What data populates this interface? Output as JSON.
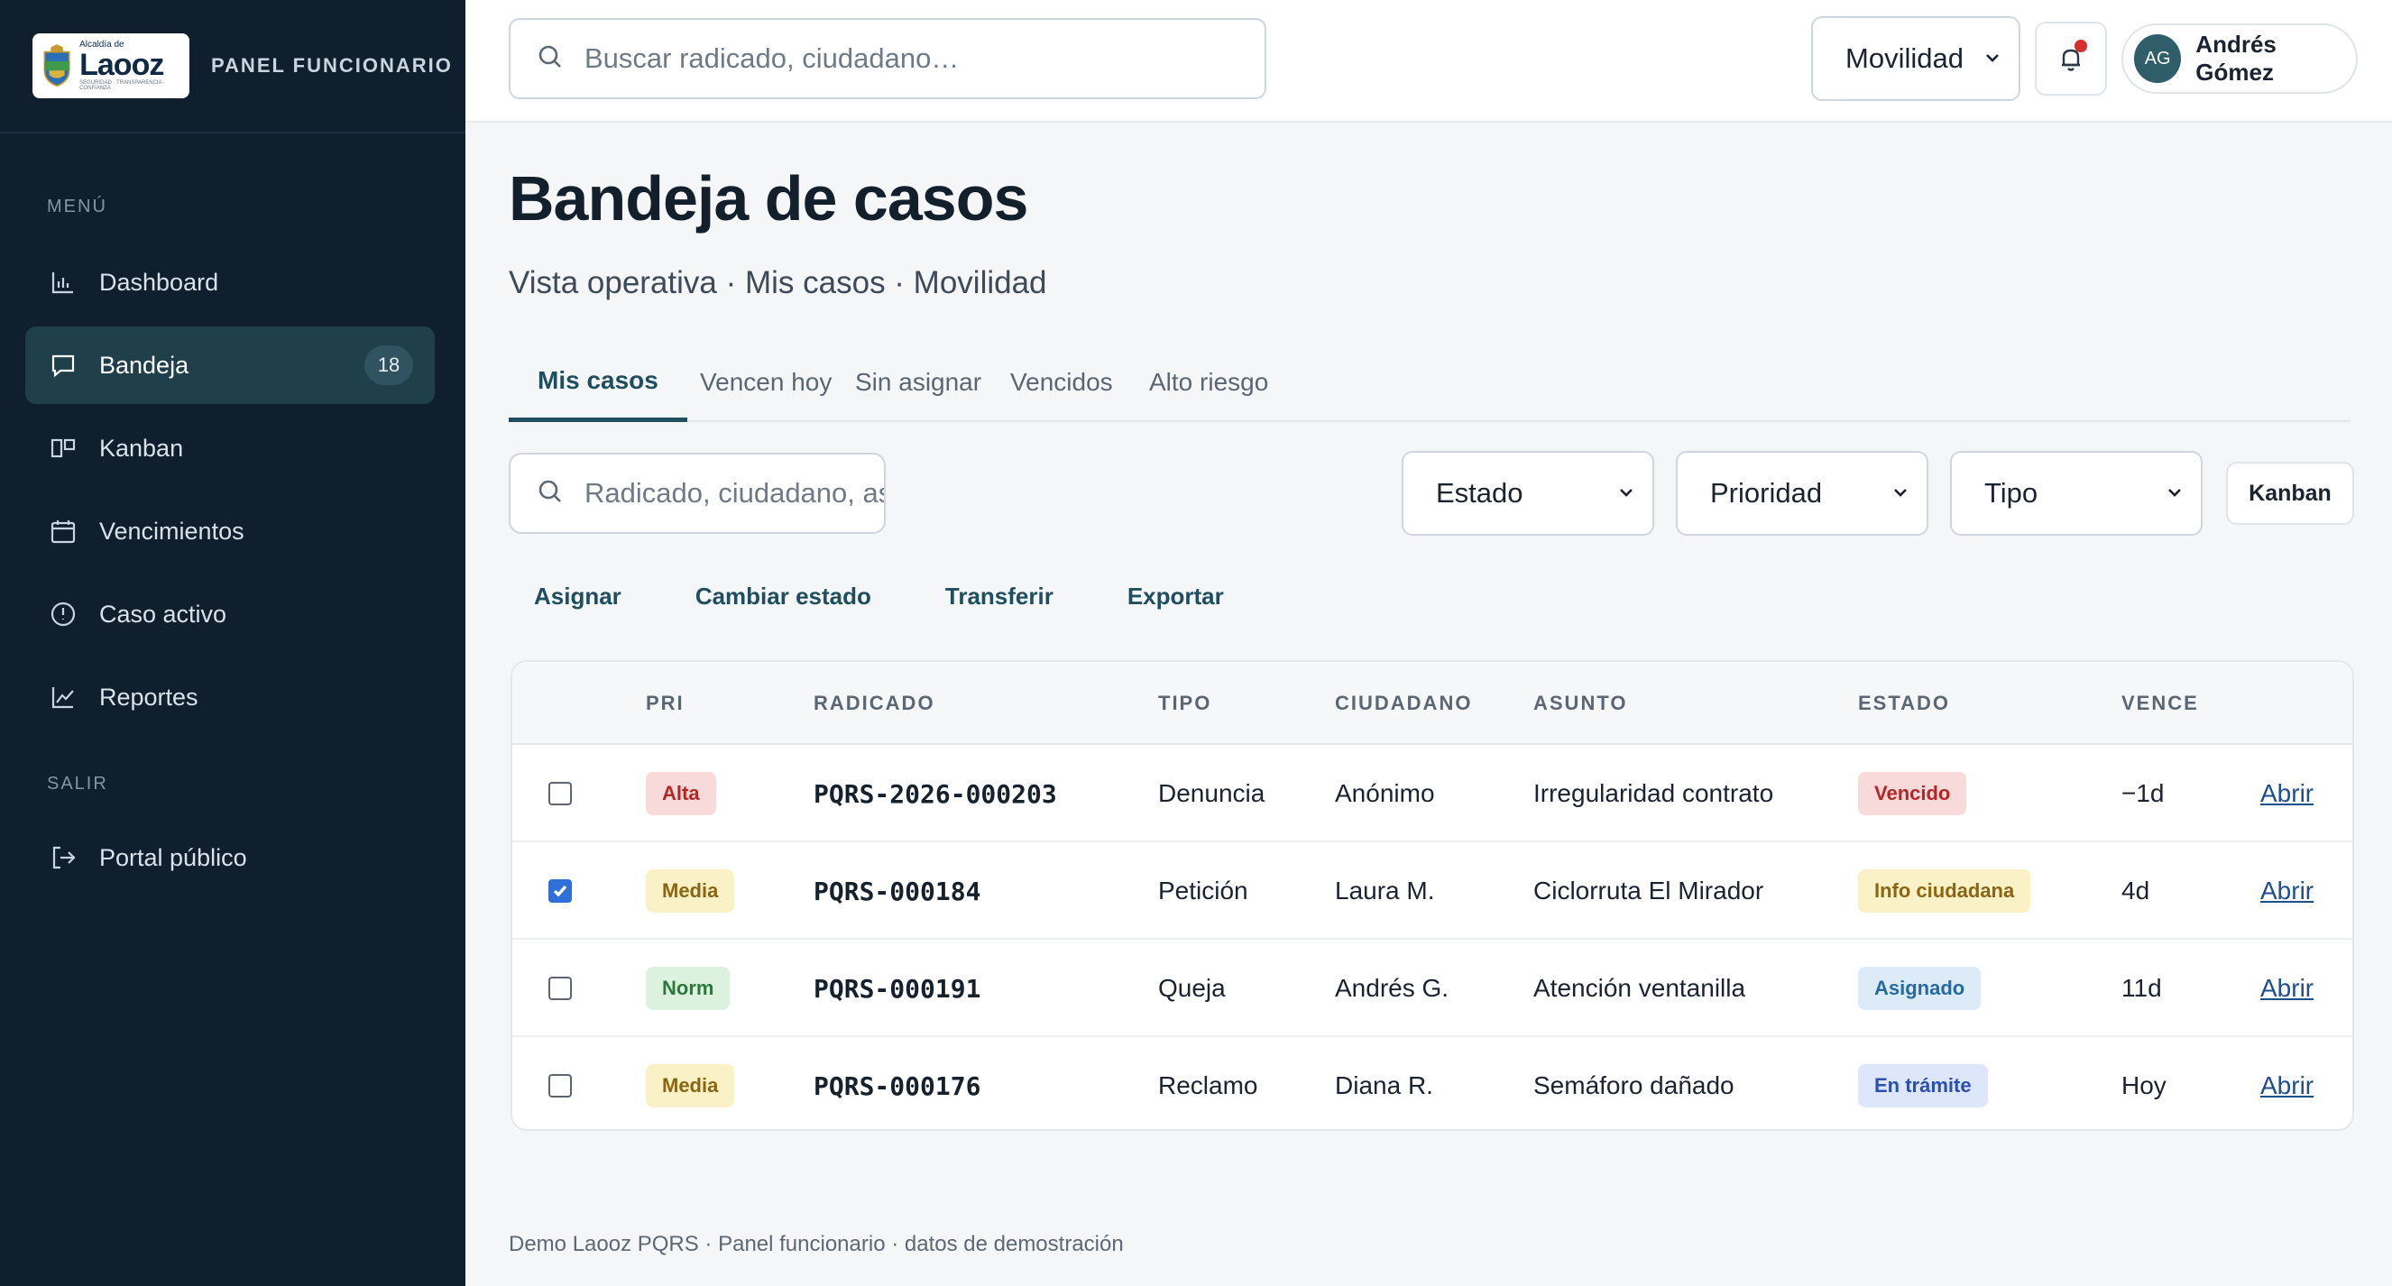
{
  "brand": {
    "logo_small": "Alcaldía de",
    "logo_big": "Laooz",
    "logo_tiny": "SEGURIDAD · TRANSPARENCIA · CONFIANZA",
    "panel_label": "PANEL FUNCIONARIO"
  },
  "sidebar": {
    "menu_label": "MENÚ",
    "items": [
      {
        "label": "Dashboard",
        "icon": "bar-chart-icon"
      },
      {
        "label": "Bandeja",
        "icon": "inbox-icon",
        "badge": "18",
        "active": true
      },
      {
        "label": "Kanban",
        "icon": "kanban-icon"
      },
      {
        "label": "Vencimientos",
        "icon": "calendar-icon"
      },
      {
        "label": "Caso activo",
        "icon": "alert-circle-icon"
      },
      {
        "label": "Reportes",
        "icon": "line-chart-icon"
      }
    ],
    "exit_label": "SALIR",
    "exit_items": [
      {
        "label": "Portal público",
        "icon": "logout-icon"
      }
    ]
  },
  "topbar": {
    "search_placeholder": "Buscar radicado, ciudadano…",
    "department": "Movilidad",
    "user_initials": "AG",
    "user_name": "Andrés Gómez"
  },
  "page": {
    "title": "Bandeja de casos",
    "subtitle": "Vista operativa · Mis casos · Movilidad"
  },
  "tabs": [
    {
      "label": "Mis casos",
      "active": true
    },
    {
      "label": "Vencen hoy"
    },
    {
      "label": "Sin asignar"
    },
    {
      "label": "Vencidos"
    },
    {
      "label": "Alto riesgo"
    }
  ],
  "filters": {
    "search_placeholder": "Radicado, ciudadano, asunto",
    "estado": "Estado",
    "prioridad": "Prioridad",
    "tipo": "Tipo",
    "kanban_label": "Kanban"
  },
  "actions": [
    "Asignar",
    "Cambiar estado",
    "Transferir",
    "Exportar"
  ],
  "table": {
    "headers": [
      "PRI",
      "RADICADO",
      "TIPO",
      "CIUDADANO",
      "ASUNTO",
      "ESTADO",
      "VENCE"
    ],
    "rows": [
      {
        "checked": false,
        "priority": "Alta",
        "radicado": "PQRS-2026-000203",
        "tipo": "Denuncia",
        "ciudadano": "Anónimo",
        "asunto": "Irregularidad contrato",
        "estado": "Vencido",
        "vence": "−1d",
        "action": "Abrir"
      },
      {
        "checked": true,
        "priority": "Media",
        "radicado": "PQRS-000184",
        "tipo": "Petición",
        "ciudadano": "Laura M.",
        "asunto": "Ciclorruta El Mirador",
        "estado": "Info ciudadana",
        "vence": "4d",
        "action": "Abrir"
      },
      {
        "checked": false,
        "priority": "Norm",
        "radicado": "PQRS-000191",
        "tipo": "Queja",
        "ciudadano": "Andrés G.",
        "asunto": "Atención ventanilla",
        "estado": "Asignado",
        "vence": "11d",
        "action": "Abrir"
      },
      {
        "checked": false,
        "priority": "Media",
        "radicado": "PQRS-000176",
        "tipo": "Reclamo",
        "ciudadano": "Diana R.",
        "asunto": "Semáforo dañado",
        "estado": "En trámite",
        "vence": "Hoy",
        "action": "Abrir"
      }
    ]
  },
  "footer": "Demo Laooz PQRS · Panel funcionario · datos de demostración",
  "colors": {
    "sidebar_bg": "#0f1f2e",
    "accent": "#1f4e5e",
    "priority_alta": "#f9dada",
    "priority_media": "#fbf1c7",
    "priority_norm": "#dcf2df",
    "estado_vencido": "#f9dada",
    "estado_info": "#fbf1c7",
    "estado_asignado": "#dcebf7",
    "estado_tramite": "#dde6fa"
  }
}
